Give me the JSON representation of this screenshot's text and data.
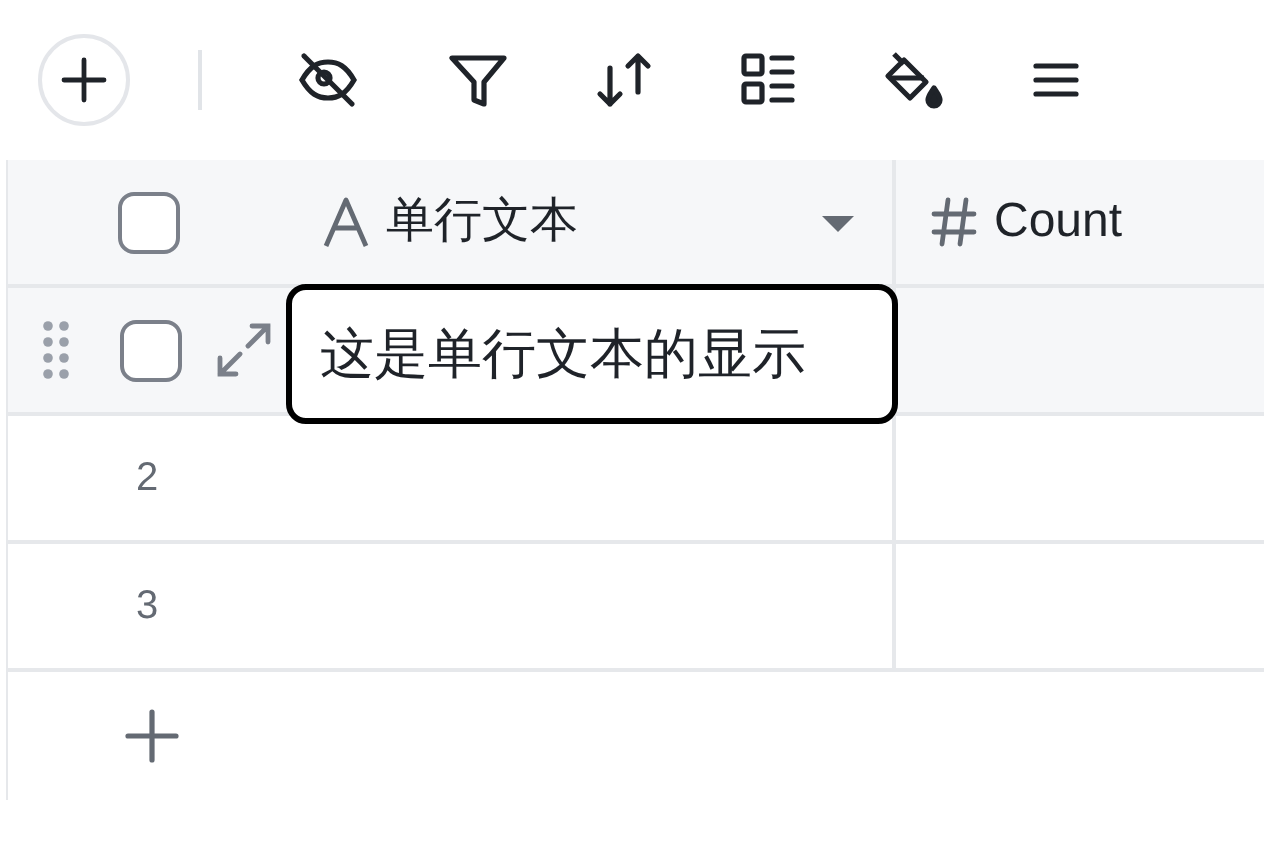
{
  "table": {
    "header_checked": false,
    "columns": [
      {
        "kind": "text",
        "label": "单行文本",
        "menu": true
      },
      {
        "kind": "number",
        "label": "Count",
        "menu": false
      }
    ],
    "rows": [
      {
        "hovered": true,
        "checked": false,
        "editing_value": "这是单行文本的显示"
      },
      {
        "hovered": false,
        "number": "2"
      },
      {
        "hovered": false,
        "number": "3"
      }
    ]
  }
}
